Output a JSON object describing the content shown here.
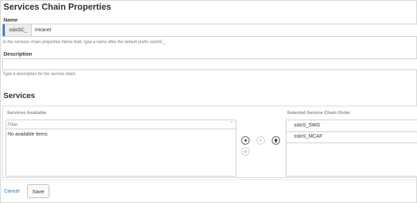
{
  "page": {
    "title": "Services Chain Properties"
  },
  "name_field": {
    "label": "Name",
    "prefix": "ssloSC_",
    "value": "Intranet",
    "help": "In the services chain properties Name field, type a name after the default prefix ssloSC_."
  },
  "description_field": {
    "label": "Description",
    "value": "",
    "help": "Type a description for the service chain."
  },
  "services": {
    "title": "Services",
    "available": {
      "header": "Services Available",
      "filter_placeholder": "Filter",
      "empty_text": "No available items"
    },
    "selected": {
      "header": "Selected Service Chain Order",
      "items": [
        "ssloS_SWG",
        "ssloS_MCAF"
      ]
    },
    "controls": {
      "move_left": "arrow-left-icon",
      "move_right": "arrow-right-icon",
      "move_up": "arrow-up-icon",
      "move_down": "arrow-down-icon"
    }
  },
  "footer": {
    "cancel_label": "Cancel",
    "save_label": "Save"
  },
  "colors": {
    "accent": "#3b7fc4",
    "link": "#1f6db5"
  }
}
